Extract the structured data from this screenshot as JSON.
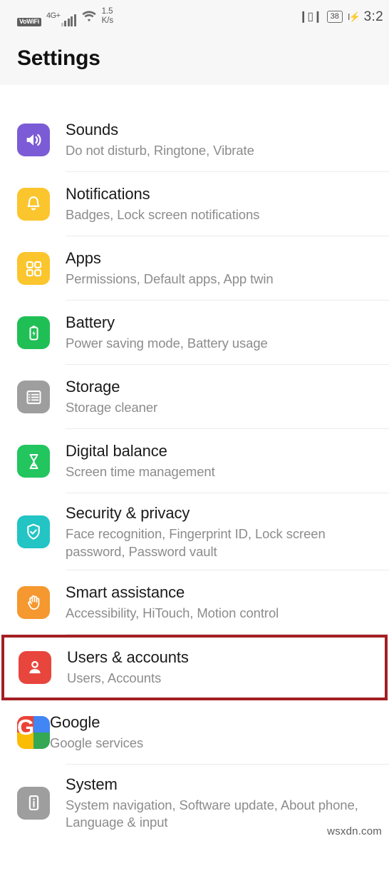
{
  "statusbar": {
    "vowifi": "VoWiFi",
    "network": "4G+",
    "speed_value": "1.5",
    "speed_unit": "K/s",
    "vibrate_icon": "vibrate-icon",
    "battery_level": "38",
    "charging_icon": "charging-bolt-icon",
    "time": "3:2"
  },
  "header": {
    "title": "Settings"
  },
  "list": {
    "items": [
      {
        "title": "Sounds",
        "subtitle": "Do not disturb, Ringtone, Vibrate",
        "icon": "speaker-icon",
        "icon_color": "#7c5cd6",
        "highlighted": false
      },
      {
        "title": "Notifications",
        "subtitle": "Badges, Lock screen notifications",
        "icon": "bell-icon",
        "icon_color": "#fbc52d",
        "highlighted": false
      },
      {
        "title": "Apps",
        "subtitle": "Permissions, Default apps, App twin",
        "icon": "grid-apps-icon",
        "icon_color": "#fbc52d",
        "highlighted": false
      },
      {
        "title": "Battery",
        "subtitle": "Power saving mode, Battery usage",
        "icon": "battery-bolt-icon",
        "icon_color": "#20bf55",
        "highlighted": false
      },
      {
        "title": "Storage",
        "subtitle": "Storage cleaner",
        "icon": "storage-stack-icon",
        "icon_color": "#9e9e9e",
        "highlighted": false
      },
      {
        "title": "Digital balance",
        "subtitle": "Screen time management",
        "icon": "hourglass-icon",
        "icon_color": "#22c55e",
        "highlighted": false
      },
      {
        "title": "Security & privacy",
        "subtitle": "Face recognition, Fingerprint ID, Lock screen password, Password vault",
        "icon": "shield-check-icon",
        "icon_color": "#22c4c4",
        "highlighted": false
      },
      {
        "title": "Smart assistance",
        "subtitle": "Accessibility, HiTouch, Motion control",
        "icon": "hand-icon",
        "icon_color": "#f5982f",
        "highlighted": false
      },
      {
        "title": "Users & accounts",
        "subtitle": "Users, Accounts",
        "icon": "person-icon",
        "icon_color": "#e8453c",
        "highlighted": true
      },
      {
        "title": "Google",
        "subtitle": "Google services",
        "icon": "google-icon",
        "icon_color": "#ffffff",
        "highlighted": false
      },
      {
        "title": "System",
        "subtitle": "System navigation, Software update, About phone, Language & input",
        "icon": "phone-info-icon",
        "icon_color": "#9e9e9e",
        "highlighted": false
      }
    ]
  },
  "annotation": {
    "highlight_color": "#a31f22"
  },
  "watermark": {
    "text": "wsxdn.com"
  }
}
